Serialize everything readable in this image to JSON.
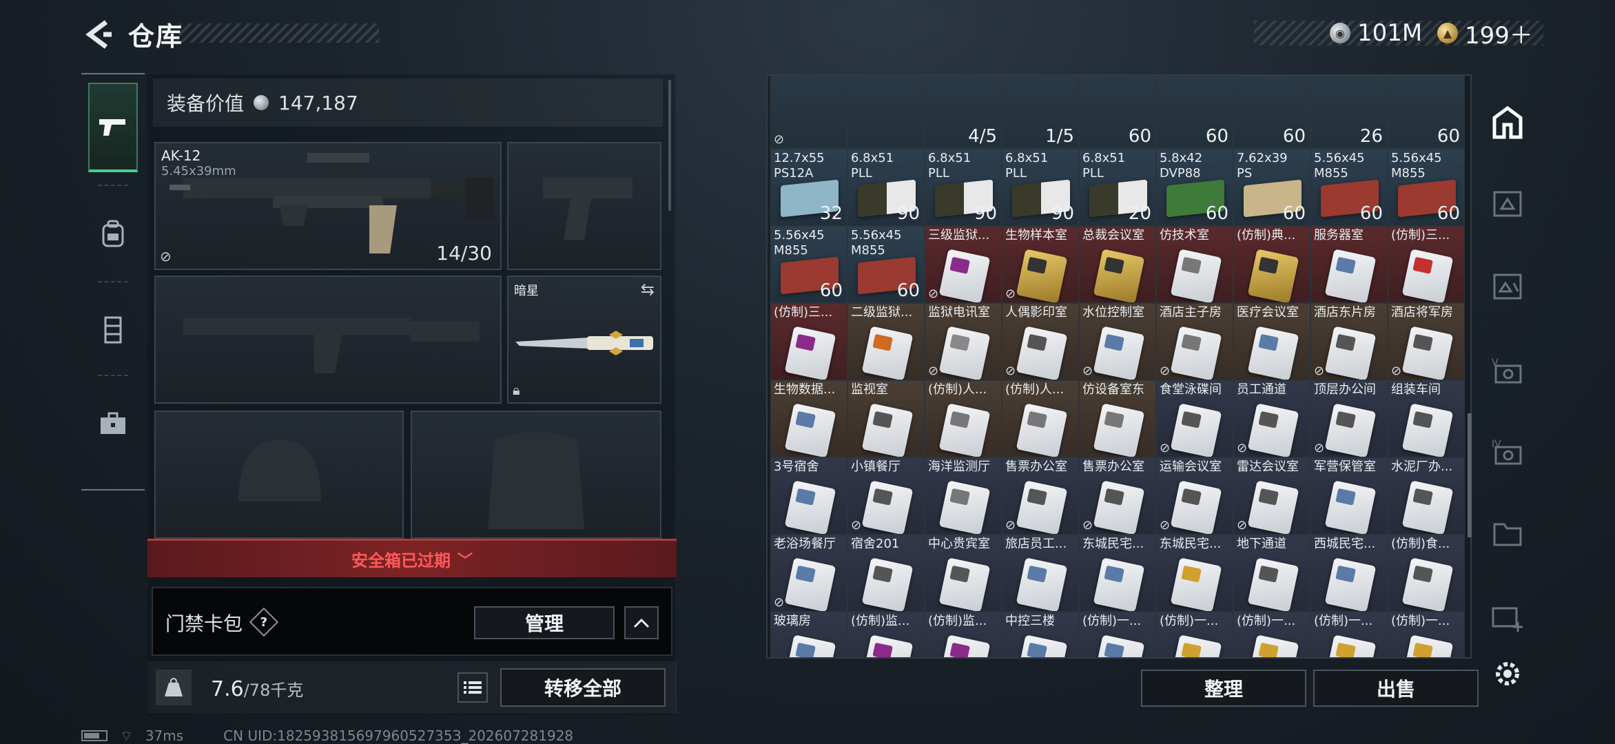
{
  "header": {
    "title": "仓库",
    "currency_silver": "101M",
    "currency_gold": "199＋"
  },
  "equipment": {
    "value_label": "装备价值",
    "value": "147,187",
    "primary_weapon": {
      "name": "AK-12",
      "caliber": "5.45x39mm",
      "ammo": "14/30"
    },
    "melee": {
      "name": "暗星"
    }
  },
  "safebox": {
    "expired_label": "安全箱已过期"
  },
  "keycard": {
    "label": "门禁卡包",
    "help": "?",
    "manage_label": "管理"
  },
  "weight": {
    "current": "7.6",
    "max": "/78",
    "unit": "千克",
    "transfer_label": "转移全部"
  },
  "warehouse": {
    "sort_label": "整理",
    "sell_label": "出售",
    "cells": [
      {
        "name": "",
        "qty": "",
        "style": "top",
        "marked": true
      },
      {
        "name": "",
        "qty": "",
        "style": "top",
        "marked": false
      },
      {
        "name": "",
        "qty": "4/5",
        "style": "top",
        "marked": false
      },
      {
        "name": "",
        "qty": "1/5",
        "style": "top",
        "marked": false
      },
      {
        "name": "",
        "qty": "60",
        "style": "top",
        "marked": false
      },
      {
        "name": "",
        "qty": "60",
        "style": "top",
        "marked": false
      },
      {
        "name": "",
        "qty": "60",
        "style": "top",
        "marked": false
      },
      {
        "name": "",
        "qty": "26",
        "style": "top",
        "marked": false
      },
      {
        "name": "",
        "qty": "60",
        "style": "top",
        "marked": false
      },
      {
        "name": "12.7x55\nPS12A",
        "qty": "32",
        "style": "ammo",
        "kind": "box",
        "color": "#8fb6c6",
        "marked": false
      },
      {
        "name": "6.8x51\nPLL",
        "qty": "90",
        "style": "ammo",
        "kind": "bullet",
        "color": "#d9d9d9",
        "marked": false
      },
      {
        "name": "6.8x51\nPLL",
        "qty": "90",
        "style": "ammo",
        "kind": "bullet",
        "color": "#d9d9d9",
        "marked": false
      },
      {
        "name": "6.8x51\nPLL",
        "qty": "90",
        "style": "ammo",
        "kind": "bullet",
        "color": "#d9d9d9",
        "marked": false
      },
      {
        "name": "6.8x51\nPLL",
        "qty": "20",
        "style": "ammo",
        "kind": "bullet",
        "color": "#d9d9d9",
        "marked": false
      },
      {
        "name": "5.8x42\nDVP88",
        "qty": "60",
        "style": "ammo",
        "kind": "box",
        "color": "#3e7a3a",
        "marked": false
      },
      {
        "name": "7.62x39\nPS",
        "qty": "60",
        "style": "ammo",
        "kind": "box",
        "color": "#c9b58a",
        "marked": false
      },
      {
        "name": "5.56x45\nM855",
        "qty": "60",
        "style": "ammo",
        "kind": "box",
        "color": "#9a3a30",
        "marked": false
      },
      {
        "name": "5.56x45\nM855",
        "qty": "60",
        "style": "ammo",
        "kind": "box",
        "color": "#9a3a30",
        "marked": false
      },
      {
        "name": "5.56x45\nM855",
        "qty": "60",
        "style": "ammo",
        "kind": "box",
        "color": "#9a3a30",
        "marked": false
      },
      {
        "name": "5.56x45\nM855",
        "qty": "60",
        "style": "ammo",
        "kind": "box",
        "color": "#9a3a30",
        "marked": false
      },
      {
        "name": "三级监狱...",
        "qty": "",
        "style": "red",
        "kind": "card",
        "color": "#8a2a8a",
        "marked": true
      },
      {
        "name": "生物样本室",
        "qty": "",
        "style": "red",
        "kind": "gold",
        "color": "#333",
        "marked": true
      },
      {
        "name": "总裁会议室",
        "qty": "",
        "style": "red",
        "kind": "gold",
        "color": "#333",
        "marked": false
      },
      {
        "name": "仿技术室",
        "qty": "",
        "style": "red",
        "kind": "card",
        "color": "#777",
        "marked": false
      },
      {
        "name": "(仿制)典...",
        "qty": "",
        "style": "red",
        "kind": "gold",
        "color": "#333",
        "marked": false
      },
      {
        "name": "服务器室",
        "qty": "",
        "style": "red",
        "kind": "card",
        "color": "#5a7aa8",
        "marked": false
      },
      {
        "name": "(仿制)三...",
        "qty": "",
        "style": "red",
        "kind": "card",
        "color": "#c43030",
        "marked": false
      },
      {
        "name": "(仿制)三...",
        "qty": "",
        "style": "red",
        "kind": "card",
        "color": "#8a2a8a",
        "marked": false
      },
      {
        "name": "二级监狱...",
        "qty": "",
        "style": "brown",
        "kind": "card",
        "color": "#d06a20",
        "marked": false
      },
      {
        "name": "监狱电讯室",
        "qty": "",
        "style": "brown",
        "kind": "card",
        "color": "#888",
        "marked": true
      },
      {
        "name": "人偶影印室",
        "qty": "",
        "style": "brown",
        "kind": "card",
        "color": "#555",
        "marked": true
      },
      {
        "name": "水位控制室",
        "qty": "",
        "style": "brown",
        "kind": "card",
        "color": "#5a7aa8",
        "marked": true
      },
      {
        "name": "酒店主子房",
        "qty": "",
        "style": "brown",
        "kind": "card",
        "color": "#777",
        "marked": true
      },
      {
        "name": "医疗会议室",
        "qty": "",
        "style": "brown",
        "kind": "card",
        "color": "#5a7aa8",
        "marked": false
      },
      {
        "name": "酒店东片房",
        "qty": "",
        "style": "brown",
        "kind": "card",
        "color": "#555",
        "marked": true
      },
      {
        "name": "酒店将军房",
        "qty": "",
        "style": "brown",
        "kind": "card",
        "color": "#555",
        "marked": true
      },
      {
        "name": "生物数据...",
        "qty": "",
        "style": "brown",
        "kind": "card",
        "color": "#5a7aa8",
        "marked": false
      },
      {
        "name": "监视室",
        "qty": "",
        "style": "brown",
        "kind": "card",
        "color": "#555",
        "marked": false
      },
      {
        "name": "(仿制)人...",
        "qty": "",
        "style": "brown",
        "kind": "card",
        "color": "#777",
        "marked": false
      },
      {
        "name": "(仿制)人...",
        "qty": "",
        "style": "brown",
        "kind": "card",
        "color": "#777",
        "marked": false
      },
      {
        "name": "仿设备室东",
        "qty": "",
        "style": "brown",
        "kind": "card",
        "color": "#777",
        "marked": false
      },
      {
        "name": "食堂泳碟间",
        "qty": "",
        "style": "blue",
        "kind": "card",
        "color": "#555",
        "marked": true
      },
      {
        "name": "员工通道",
        "qty": "",
        "style": "blue",
        "kind": "card",
        "color": "#555",
        "marked": true
      },
      {
        "name": "顶层办公间",
        "qty": "",
        "style": "blue",
        "kind": "card",
        "color": "#555",
        "marked": true
      },
      {
        "name": "组装车间",
        "qty": "",
        "style": "blue",
        "kind": "card",
        "color": "#555",
        "marked": false
      },
      {
        "name": "3号宿舍",
        "qty": "",
        "style": "blue",
        "kind": "card",
        "color": "#5a7aa8",
        "marked": false
      },
      {
        "name": "小镇餐厅",
        "qty": "",
        "style": "blue",
        "kind": "card",
        "color": "#555",
        "marked": true
      },
      {
        "name": "海洋监测厅",
        "qty": "",
        "style": "blue",
        "kind": "card",
        "color": "#777",
        "marked": false
      },
      {
        "name": "售票办公室",
        "qty": "",
        "style": "blue",
        "kind": "card",
        "color": "#555",
        "marked": true
      },
      {
        "name": "售票办公室",
        "qty": "",
        "style": "blue",
        "kind": "card",
        "color": "#555",
        "marked": true
      },
      {
        "name": "运输会议室",
        "qty": "",
        "style": "blue",
        "kind": "card",
        "color": "#555",
        "marked": true
      },
      {
        "name": "雷达会议室",
        "qty": "",
        "style": "blue",
        "kind": "card",
        "color": "#555",
        "marked": true
      },
      {
        "name": "军营保管室",
        "qty": "",
        "style": "blue",
        "kind": "card",
        "color": "#5a7aa8",
        "marked": false
      },
      {
        "name": "水泥厂办...",
        "qty": "",
        "style": "blue",
        "kind": "card",
        "color": "#555",
        "marked": false
      },
      {
        "name": "老浴场餐厅",
        "qty": "",
        "style": "blue",
        "kind": "card",
        "color": "#5a7aa8",
        "marked": true
      },
      {
        "name": "宿舍201",
        "qty": "",
        "style": "blue",
        "kind": "card",
        "color": "#555",
        "marked": false
      },
      {
        "name": "中心贵宾室",
        "qty": "",
        "style": "blue",
        "kind": "card",
        "color": "#555",
        "marked": false
      },
      {
        "name": "旅店员工...",
        "qty": "",
        "style": "blue",
        "kind": "card",
        "color": "#5a7aa8",
        "marked": false
      },
      {
        "name": "东城民宅...",
        "qty": "",
        "style": "blue",
        "kind": "card",
        "color": "#5a7aa8",
        "marked": false
      },
      {
        "name": "东城民宅...",
        "qty": "",
        "style": "blue",
        "kind": "card",
        "color": "#d0a030",
        "marked": false
      },
      {
        "name": "地下通道",
        "qty": "",
        "style": "blue",
        "kind": "card",
        "color": "#555",
        "marked": false
      },
      {
        "name": "西城民宅...",
        "qty": "",
        "style": "blue",
        "kind": "card",
        "color": "#5a7aa8",
        "marked": false
      },
      {
        "name": "(仿制)食...",
        "qty": "",
        "style": "blue",
        "kind": "card",
        "color": "#555",
        "marked": false
      },
      {
        "name": "玻璃房",
        "qty": "",
        "style": "blue",
        "kind": "card",
        "color": "#5a7aa8",
        "marked": false
      },
      {
        "name": "(仿制)监...",
        "qty": "",
        "style": "blue",
        "kind": "card",
        "color": "#8a2a8a",
        "marked": false
      },
      {
        "name": "(仿制)监...",
        "qty": "",
        "style": "blue",
        "kind": "card",
        "color": "#8a2a8a",
        "marked": false
      },
      {
        "name": "中控三楼",
        "qty": "",
        "style": "blue",
        "kind": "card",
        "color": "#5a7aa8",
        "marked": false
      },
      {
        "name": "(仿制)一...",
        "qty": "",
        "style": "blue",
        "kind": "card",
        "color": "#5a7aa8",
        "marked": false
      },
      {
        "name": "(仿制)一...",
        "qty": "",
        "style": "blue",
        "kind": "card",
        "color": "#d0a030",
        "marked": false
      },
      {
        "name": "(仿制)一...",
        "qty": "",
        "style": "blue",
        "kind": "card",
        "color": "#d0a030",
        "marked": false
      },
      {
        "name": "(仿制)一...",
        "qty": "",
        "style": "blue",
        "kind": "card",
        "color": "#d0a030",
        "marked": false
      },
      {
        "name": "(仿制)一...",
        "qty": "",
        "style": "blue",
        "kind": "card",
        "color": "#d0a030",
        "marked": false
      }
    ]
  },
  "status": {
    "ping": "37ms",
    "uid": "CN UID:18259381569796052735З_202607281928"
  }
}
